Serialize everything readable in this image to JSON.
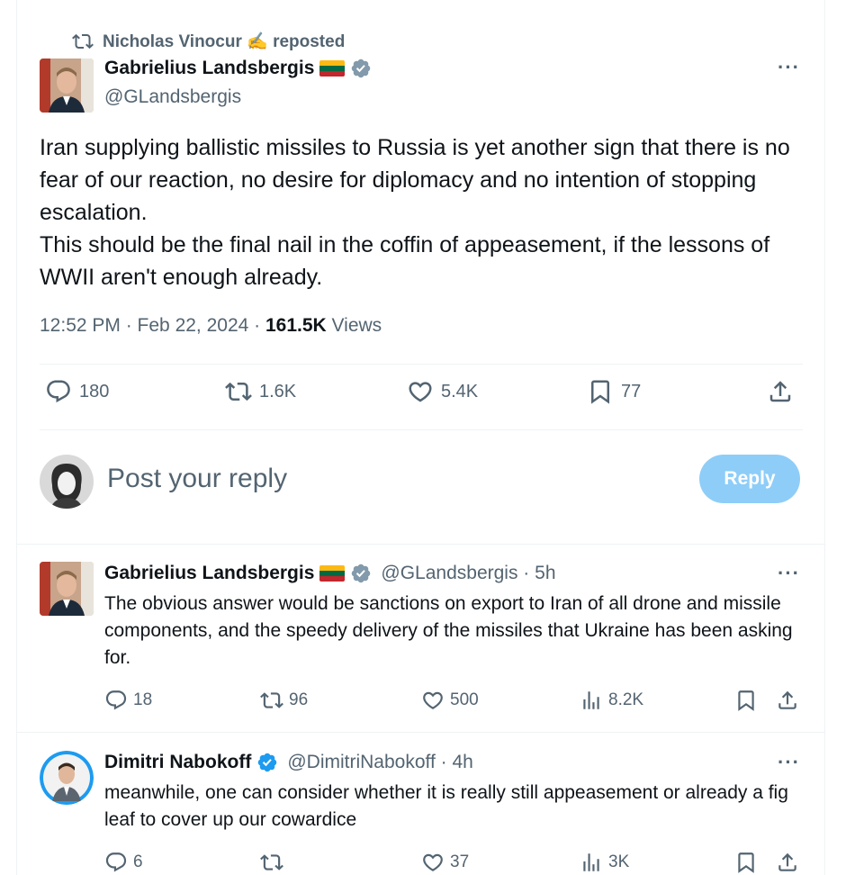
{
  "repost": {
    "text": "Nicholas Vinocur ✍️ reposted"
  },
  "main": {
    "name": "Gabrielius Landsbergis",
    "handle": "@GLandsbergis",
    "paragraphs": [
      "Iran supplying ballistic missiles to Russia is yet another sign that there is no fear of our reaction, no desire for diplomacy and no intention of stopping escalation.",
      "This should be the final nail in the coffin of appeasement, if the lessons of WWII aren't enough already."
    ],
    "time": "12:52 PM · Feb 22, 2024 · ",
    "views_count": "161.5K",
    "views_label": " Views",
    "stats": {
      "replies": "180",
      "reposts": "1.6K",
      "likes": "5.4K",
      "bookmarks": "77"
    }
  },
  "composer": {
    "placeholder": "Post your reply",
    "button": "Reply"
  },
  "replies": [
    {
      "name": "Gabrielius Landsbergis",
      "handle": "@GLandsbergis · 5h",
      "text": "The obvious answer would be sanctions on export to Iran of all drone and missile components, and the speedy delivery of the missiles that Ukraine has been asking for.",
      "stats": {
        "replies": "18",
        "reposts": "96",
        "likes": "500",
        "views": "8.2K"
      }
    },
    {
      "name": "Dimitri Nabokoff",
      "handle": "@DimitriNabokoff · 4h",
      "text": "meanwhile, one can consider whether it is really still appeasement or already a fig leaf to cover up our cowardice",
      "stats": {
        "replies": "6",
        "reposts": "",
        "likes": "37",
        "views": "3K"
      }
    }
  ],
  "colors": {
    "accent": "#1d9bf0",
    "reply_button": "#8ecdf8",
    "muted": "#536471",
    "flag": [
      "#fdb913",
      "#006a44",
      "#c1272d"
    ]
  }
}
